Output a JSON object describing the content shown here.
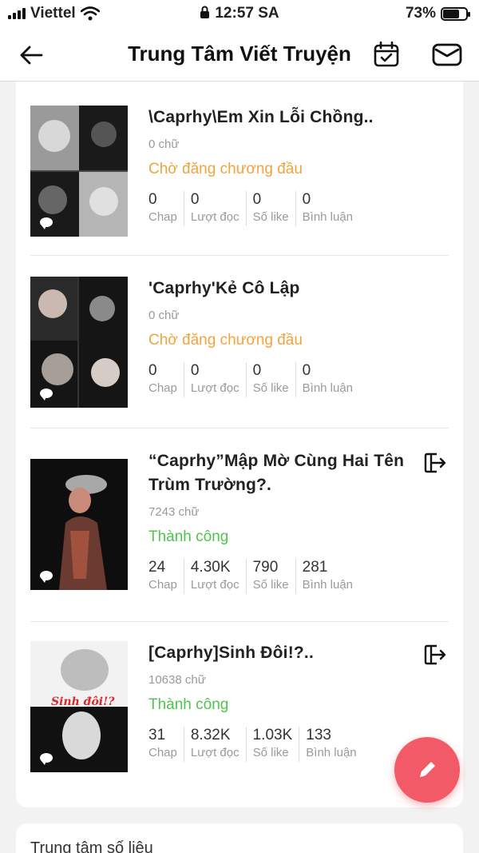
{
  "status": {
    "carrier": "Viettel",
    "time": "12:57 SA",
    "battery": "73%",
    "battery_level": 0.73,
    "icons": [
      "signal-icon",
      "wifi-icon",
      "lock-icon",
      "battery-icon"
    ]
  },
  "header": {
    "title": "Trung Tâm Viết Truyện",
    "icons": [
      "back-arrow-icon",
      "calendar-check-icon",
      "mail-icon"
    ]
  },
  "stories": [
    {
      "title": "\\Caprhy\\Em Xin Lỗi Chồng..",
      "words": "0 chữ",
      "status": "Chờ đăng chương đầu",
      "status_type": "pending",
      "stats": [
        {
          "value": "0",
          "label": "Chap"
        },
        {
          "value": "0",
          "label": "Lượt đọc"
        },
        {
          "value": "0",
          "label": "Số like"
        },
        {
          "value": "0",
          "label": "Bình luận"
        }
      ]
    },
    {
      "title": "'Caprhy'Kẻ Cô Lập",
      "words": "0 chữ",
      "status": "Chờ đăng chương đầu",
      "status_type": "pending",
      "stats": [
        {
          "value": "0",
          "label": "Chap"
        },
        {
          "value": "0",
          "label": "Lượt đọc"
        },
        {
          "value": "0",
          "label": "Số like"
        },
        {
          "value": "0",
          "label": "Bình luận"
        }
      ]
    },
    {
      "title": "“Caprhy”Mập Mờ Cùng Hai Tên Trùm Trường?.",
      "words": "7243 chữ",
      "status": "Thành công",
      "status_type": "success",
      "stats": [
        {
          "value": "24",
          "label": "Chap"
        },
        {
          "value": "4.30K",
          "label": "Lượt đọc"
        },
        {
          "value": "790",
          "label": "Số like"
        },
        {
          "value": "281",
          "label": "Bình luận"
        }
      ]
    },
    {
      "title": "[Caprhy]Sinh Đôi!?..",
      "words": "10638 chữ",
      "status": "Thành công",
      "status_type": "success",
      "cover_text": "Sinh đôi!?",
      "stats": [
        {
          "value": "31",
          "label": "Chap"
        },
        {
          "value": "8.32K",
          "label": "Lượt đọc"
        },
        {
          "value": "1.03K",
          "label": "Số like"
        },
        {
          "value": "133",
          "label": "Bình luận"
        }
      ]
    }
  ],
  "stats_section": {
    "title": "Trung tâm số liệu"
  },
  "colors": {
    "pending": "#f2a43a",
    "success": "#4fc44f",
    "fab": "#f25a67"
  }
}
